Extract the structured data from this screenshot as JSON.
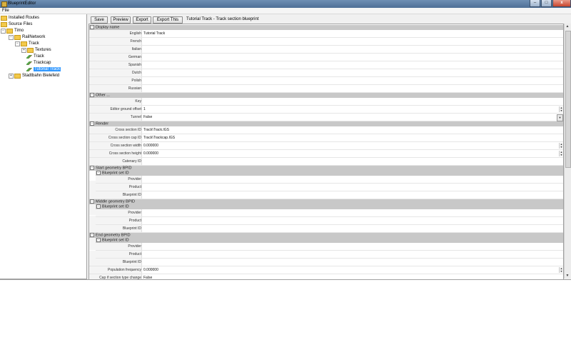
{
  "window": {
    "title": "BlueprintEditor",
    "minimize": "–",
    "maximize": "□",
    "close": "x"
  },
  "menu": {
    "file": "File"
  },
  "tree": [
    {
      "label": "Installed Routes",
      "kind": "folder",
      "expander": ""
    },
    {
      "label": "Source Files",
      "kind": "folder",
      "expander": ""
    },
    {
      "label": "Timo",
      "kind": "folder",
      "expander": "−"
    },
    {
      "label": "RailNetwork",
      "kind": "folder",
      "expander": "−"
    },
    {
      "label": "Track",
      "kind": "folder",
      "expander": "−"
    },
    {
      "label": "Textures",
      "kind": "folder",
      "expander": "+"
    },
    {
      "label": "Track",
      "kind": "track",
      "expander": ""
    },
    {
      "label": "Trackcap",
      "kind": "track",
      "expander": ""
    },
    {
      "label": "Tutorial Track",
      "kind": "track",
      "expander": "",
      "selected": true
    },
    {
      "label": "Stadtbahn Bielefeld",
      "kind": "folder",
      "expander": "+"
    }
  ],
  "toolbar": {
    "save": "Save",
    "preview": "Preview",
    "export": "Export",
    "export_this": "Export This",
    "caption": "Tutorial Track - Track section blueprint"
  },
  "sections": {
    "display_name": "Display name",
    "other": "Other ...",
    "render": "Render",
    "start_geometry": "Start geometry BPID",
    "middle_geometry": "Middle geometry BPID",
    "end_geometry": "End geometry BPID",
    "blueprint_set_id": "Blueprint set ID"
  },
  "labels": {
    "english": "English",
    "french": "French",
    "italian": "Italian",
    "german": "German",
    "spanish": "Spanish",
    "dutch": "Dutch",
    "polish": "Polish",
    "russian": "Russian",
    "key": "Key",
    "editor_ground_offset": "Editor ground offset",
    "tunnel": "Tunnel",
    "cross_section_id": "Cross section ID",
    "cross_section_cap_id": "Cross section cap ID",
    "cross_section_width": "Cross section width",
    "cross_section_height": "Cross section height",
    "catenary_id": "Catenary ID",
    "provider": "Provider",
    "product": "Product",
    "blueprint_id": "Blueprint ID",
    "population_frequency": "Population frequency",
    "cap_if_section_type_change": "Cap if section type change"
  },
  "values": {
    "english": "Tutorial Track",
    "editor_ground_offset": "1",
    "tunnel": "False",
    "cross_section_id": "Track\\Track.IGS",
    "cross_section_cap_id": "Track\\Trackcap.IGS",
    "cross_section_width": "0.000000",
    "cross_section_height": "0.000000",
    "population_frequency": "0.000000",
    "cap_if_section_type_change": "False"
  }
}
